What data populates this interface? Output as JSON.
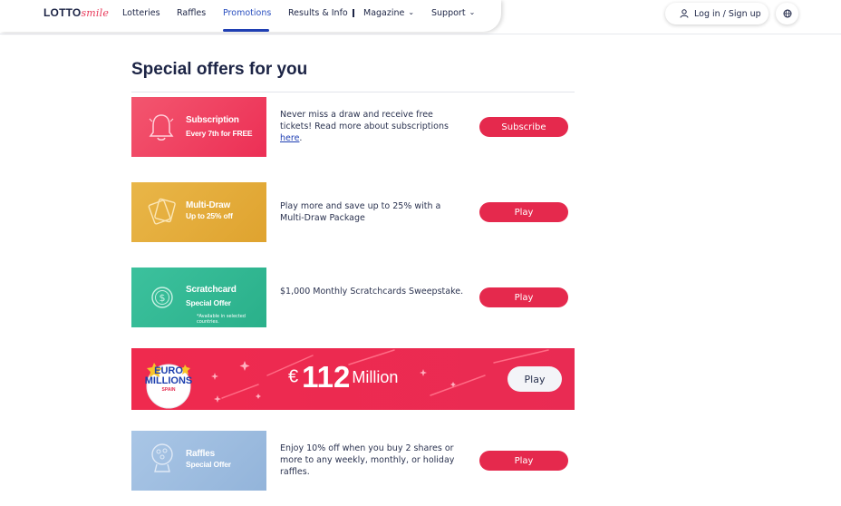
{
  "header": {
    "logo_main": "LOTTO",
    "logo_script": "smile",
    "nav": [
      {
        "label": "Lotteries"
      },
      {
        "label": "Raffles"
      },
      {
        "label": "Promotions",
        "active": true
      },
      {
        "label": "Results & Info"
      },
      {
        "label": "Magazine",
        "dropdown": true
      },
      {
        "label": "Support",
        "dropdown": true
      }
    ],
    "login_label": "Log in / Sign up",
    "globe_icon": "globe-icon"
  },
  "page": {
    "title": "Special offers for you"
  },
  "offers": [
    {
      "image_title": "Subscription",
      "image_subtitle": "Every 7th for FREE",
      "icon": "bell-icon",
      "color": "#ef3b5e",
      "description": "Never miss a draw and receive free tickets! Read more about subscriptions ",
      "link_text": "here",
      "description_end": ".",
      "button": "Subscribe"
    },
    {
      "image_title": "Multi-Draw",
      "image_subtitle": "Up to 25% off",
      "icon": "tickets-icon",
      "color": "#e4ab3a",
      "description": "Play more and save up to 25% with a Multi-Draw Package",
      "button": "Play"
    },
    {
      "image_title": "Scratchcard",
      "image_subtitle": "Special Offer",
      "image_note": "*Available in selected countries.",
      "icon": "coin-icon",
      "color": "#34b893",
      "description": "$1,000 Monthly Scratchcards Sweepstake.",
      "button": "Play"
    },
    {
      "image_title": "Raffles",
      "image_subtitle": "Special Offer",
      "icon": "raffle-drum-icon",
      "color": "#9ebde0",
      "description": "Enjoy 10% off when you buy 2 shares or more to any weekly, monthly, or holiday raffles.",
      "button": "Play"
    }
  ],
  "banner": {
    "logo_line1": "EURO",
    "logo_line2": "MILLIONS",
    "logo_line3": "SPAIN",
    "currency": "€",
    "amount": "112",
    "unit": "Million",
    "button": "Play",
    "color": "#ef2a4e"
  }
}
